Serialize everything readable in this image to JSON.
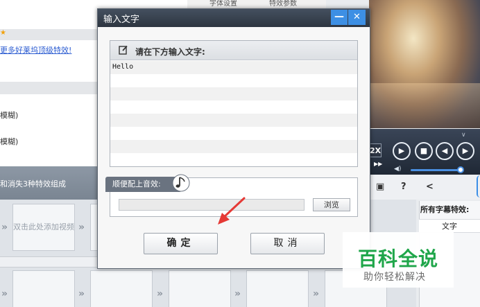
{
  "background": {
    "tabs": [
      "字体设置",
      "特效参数"
    ],
    "link_text": "更多好莱坞顶级特效!",
    "blur_items": [
      "模糊)",
      "模糊)"
    ],
    "strip_text": "和消失3种特效组成",
    "add_video_text": "双击此处添加视频",
    "speed_label": "2X",
    "effects_panel": {
      "title": "所有字幕特效:",
      "item": "文字"
    }
  },
  "dialog": {
    "title": "输入文字",
    "minimize_label": "—",
    "close_label": "✕",
    "text_panel_label": "请在下方输入文字:",
    "text_value": "Hello",
    "audio_label": "顺便配上音效:",
    "browse_label": "浏览",
    "ok_label": "确定",
    "cancel_label": "取消"
  },
  "watermark": {
    "title": "百科全说",
    "subtitle": "助你轻松解决"
  },
  "colors": {
    "accent_blue": "#3d8fe4",
    "watermark_green": "#1fa64a",
    "arrow_red": "#e53935"
  }
}
